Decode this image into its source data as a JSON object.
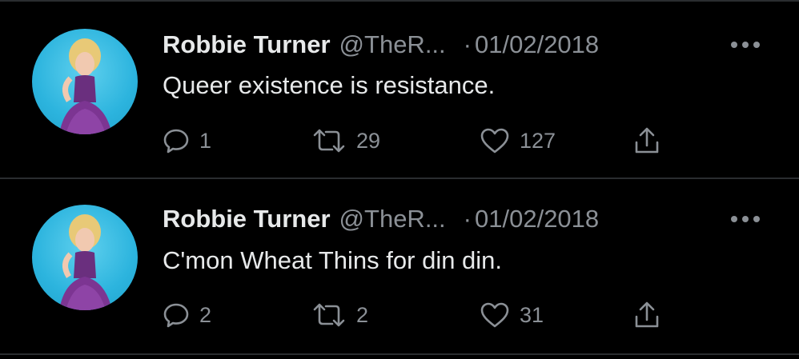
{
  "tweets": [
    {
      "author": "Robbie Turner",
      "handle": "@TheR...",
      "separator": "·",
      "date": "01/02/2018",
      "text": "Queer existence is resistance.",
      "replies": "1",
      "retweets": "29",
      "likes": "127"
    },
    {
      "author": "Robbie Turner",
      "handle": "@TheR...",
      "separator": "·",
      "date": "01/02/2018",
      "text": "C'mon Wheat Thins for din din.",
      "replies": "2",
      "retweets": "2",
      "likes": "31"
    }
  ],
  "icons": {
    "reply": "reply-icon",
    "retweet": "retweet-icon",
    "like": "heart-icon",
    "share": "share-icon",
    "more": "more-icon"
  },
  "colors": {
    "background": "#000000",
    "text": "#e7e9ea",
    "muted": "#8b9096",
    "divider": "#2a2d30",
    "avatar_bg": "#2cb4de"
  }
}
